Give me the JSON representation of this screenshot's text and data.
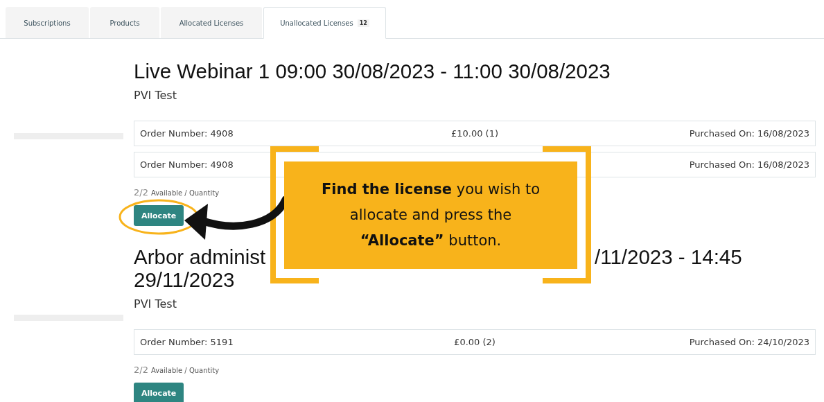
{
  "tabs": [
    {
      "label": "Subscriptions",
      "selected": false
    },
    {
      "label": "Products",
      "selected": false
    },
    {
      "label": "Allocated Licenses",
      "selected": false
    },
    {
      "label": "Unallocated Licenses",
      "selected": true,
      "badge": "12"
    }
  ],
  "licenses": [
    {
      "title_lines": [
        [
          "Live Webinar 1 09:00 30/08/2023 - 11:00 30/08/2023"
        ]
      ],
      "subtitle": "PVI Test",
      "orders": [
        {
          "number": "Order Number: 4908",
          "price": "£10.00 (1)",
          "purchased": "Purchased On: 16/08/2023"
        },
        {
          "number": "Order Number: 4908",
          "purchased": "Purchased On: 16/08/2023"
        }
      ],
      "available": "2/2",
      "available_label": "Available / Quantity",
      "button": "Allocate",
      "highlighted": true
    },
    {
      "title_lines": [
        [
          "Arbor administ",
          "/11/2023 - 14:45"
        ],
        [
          "29/11/2023"
        ]
      ],
      "subtitle": "PVI Test",
      "orders": [
        {
          "number": "Order Number: 5191",
          "price": "£0.00 (2)",
          "purchased": "Purchased On: 24/10/2023"
        }
      ],
      "available": "2/2",
      "available_label": "Available / Quantity",
      "button": "Allocate",
      "highlighted": false
    }
  ],
  "callout": {
    "text": "**Find the license** you wish to allocate and press the **“Allocate”** button."
  }
}
